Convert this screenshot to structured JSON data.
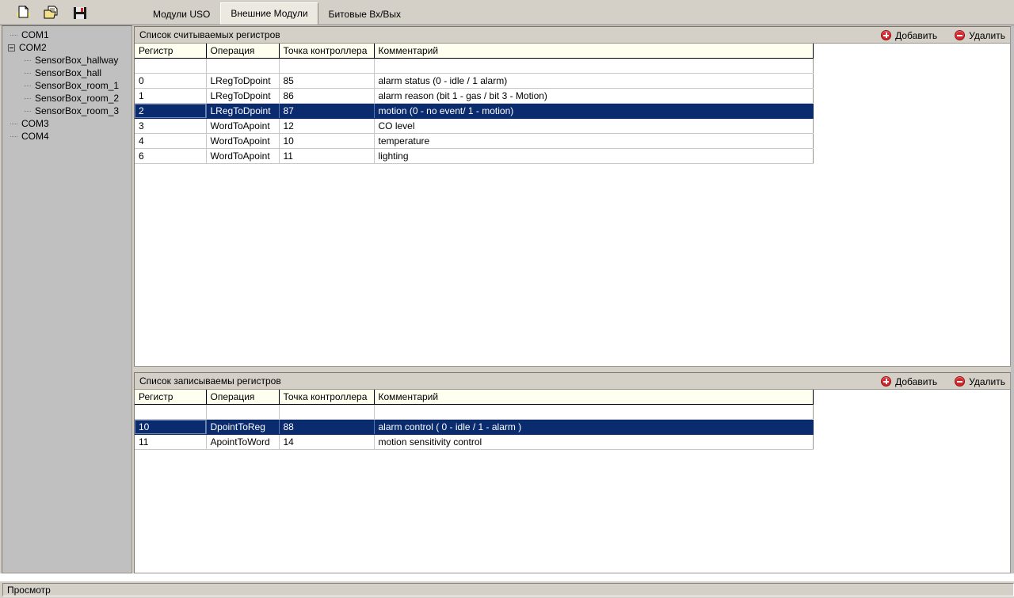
{
  "toolbar": {
    "buttons": [
      {
        "name": "new-file-icon",
        "label": "Создать"
      },
      {
        "name": "open-file-icon",
        "label": "Открыть"
      },
      {
        "name": "save-file-icon",
        "label": "Сохранить"
      }
    ]
  },
  "tabs": [
    {
      "label": "Модули USO",
      "active": false
    },
    {
      "label": "Внешние Модули",
      "active": true
    },
    {
      "label": "Битовые Вх/Вых",
      "active": false
    }
  ],
  "sidebar": {
    "nodes": [
      {
        "label": "COM1",
        "level": 0,
        "expander": false
      },
      {
        "label": "COM2",
        "level": 0,
        "expander": true
      },
      {
        "label": "SensorBox_hallway",
        "level": 1,
        "expander": false
      },
      {
        "label": "SensorBox_hall",
        "level": 1,
        "expander": false
      },
      {
        "label": "SensorBox_room_1",
        "level": 1,
        "expander": false
      },
      {
        "label": "SensorBox_room_2",
        "level": 1,
        "expander": false
      },
      {
        "label": "SensorBox_room_3",
        "level": 1,
        "expander": false
      },
      {
        "label": "COM3",
        "level": 0,
        "expander": false
      },
      {
        "label": "COM4",
        "level": 0,
        "expander": false
      }
    ]
  },
  "panels": {
    "read": {
      "title": "Список считываемых регистров",
      "add_label": "Добавить",
      "delete_label": "Удалить",
      "columns": [
        "Регистр",
        "Операция",
        "Точка контроллера",
        "Комментарий"
      ],
      "rows": [
        {
          "register": "",
          "operation": "",
          "point": "",
          "comment": "",
          "selected": false,
          "spacer": true
        },
        {
          "register": "0",
          "operation": "LRegToDpoint",
          "point": "85",
          "comment": "alarm status (0 - idle / 1 alarm)",
          "selected": false
        },
        {
          "register": "1",
          "operation": "LRegToDpoint",
          "point": "86",
          "comment": "alarm reason (bit 1 - gas / bit 3 - Motion)",
          "selected": false
        },
        {
          "register": "2",
          "operation": "LRegToDpoint",
          "point": "87",
          "comment": "motion (0 - no event/ 1 - motion)",
          "selected": true
        },
        {
          "register": "3",
          "operation": "WordToApoint",
          "point": "12",
          "comment": "CO level",
          "selected": false
        },
        {
          "register": "4",
          "operation": "WordToApoint",
          "point": "10",
          "comment": "temperature",
          "selected": false
        },
        {
          "register": "6",
          "operation": "WordToApoint",
          "point": "11",
          "comment": "lighting",
          "selected": false
        }
      ]
    },
    "write": {
      "title": "Список записываемы регистров",
      "add_label": "Добавить",
      "delete_label": "Удалить",
      "columns": [
        "Регистр",
        "Операция",
        "Точка контроллера",
        "Комментарий"
      ],
      "rows": [
        {
          "register": "",
          "operation": "",
          "point": "",
          "comment": "",
          "selected": false,
          "spacer": true
        },
        {
          "register": "10",
          "operation": "DpointToReg",
          "point": "88",
          "comment": "alarm control ( 0 - idle / 1 - alarm )",
          "selected": true
        },
        {
          "register": "11",
          "operation": "ApointToWord",
          "point": "14",
          "comment": "motion sensitivity control",
          "selected": false
        }
      ]
    }
  },
  "statusbar": {
    "text": "Просмотр"
  },
  "colors": {
    "window_face": "#d4d0c8",
    "tree_face": "#c0c0c0",
    "selection": "#0a2b6e",
    "header_cell": "#fffff0",
    "accent_red": "#d8242a"
  }
}
